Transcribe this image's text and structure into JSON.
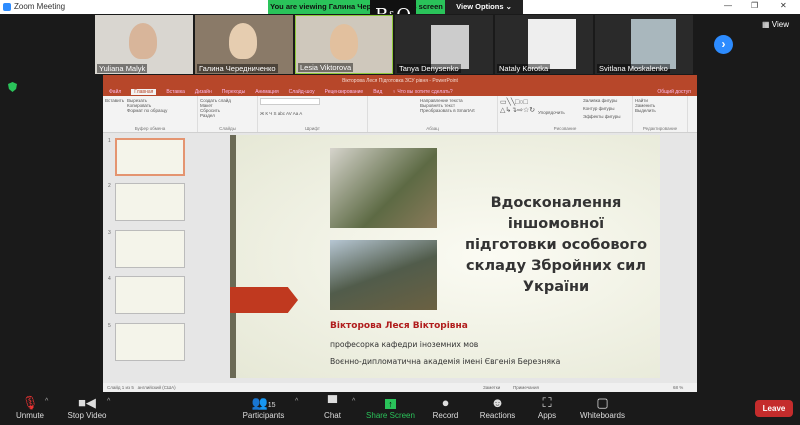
{
  "window": {
    "title": "Zoom Meeting",
    "minimize": "—",
    "restore": "❐",
    "close": "✕"
  },
  "banner": {
    "text": "You are viewing Галина Чередниченко's screen",
    "view_options": "View Options ⌄"
  },
  "logo": "B&O",
  "participants_strip": [
    {
      "name": "Yuliana Malyk",
      "muted": true
    },
    {
      "name": "Галина Чередниченко",
      "muted": false
    },
    {
      "name": "Lesia Viktorova",
      "muted": false,
      "active": true
    },
    {
      "name": "Tanya Denysenko",
      "muted": false
    },
    {
      "name": "Nataly Korotka",
      "muted": true
    },
    {
      "name": "Svitlana Moskalenko",
      "muted": true
    }
  ],
  "view_button": "View",
  "powerpoint": {
    "title": "Вікторова Леся Підготовка ЗСУ рівня - PowerPoint",
    "tabs": [
      "Файл",
      "Главная",
      "Вставка",
      "Дизайн",
      "Переходы",
      "Анимация",
      "Слайд-шоу",
      "Рецензирование",
      "Вид",
      "♀ Что вы хотите сделать?"
    ],
    "share": "Общий доступ",
    "ribbon_groups": [
      {
        "label": "Буфер обмена",
        "items": [
          "Вставить",
          "Вырезать",
          "Копировать",
          "Формат по образцу"
        ]
      },
      {
        "label": "Слайды",
        "items": [
          "Создать слайд",
          "Макет",
          "Сбросить",
          "Раздел"
        ]
      },
      {
        "label": "Шрифт",
        "items": [
          "Ж К Ч S abc AV Aa A"
        ]
      },
      {
        "label": "Абзац",
        "items": [
          "Направление текста",
          "Выровнять текст",
          "Преобразовать в SmartArt"
        ]
      },
      {
        "label": "Рисование",
        "items": [
          "Упорядочить",
          "Экспресс-стили",
          "Заливка фигуры",
          "Контур фигуры",
          "Эффекты фигуры"
        ]
      },
      {
        "label": "Редактирование",
        "items": [
          "Найти",
          "Заменить",
          "Выделить"
        ]
      }
    ],
    "thumbnails": [
      "1",
      "2",
      "3",
      "4",
      "5"
    ],
    "slide": {
      "title": "Вдосконалення іншомовної підготовки особового складу  Збройних сил України",
      "author": "Вікторова Леся Вікторівна",
      "position": "професорка кафедри іноземних мов",
      "institution": "Воєнно-дипломатична академія імені Євгенія Березняка"
    },
    "status": {
      "slide": "Слайд 1 из 5",
      "language": "английский (США)",
      "notes": "Заметки",
      "comments": "Примечания",
      "zoom": "68 %"
    }
  },
  "toolbar": [
    {
      "label": "Unmute",
      "icon": "mic-muted-icon"
    },
    {
      "label": "Stop Video",
      "icon": "video-icon"
    },
    {
      "label": "Participants",
      "icon": "participants-icon",
      "count": "15"
    },
    {
      "label": "Chat",
      "icon": "chat-icon"
    },
    {
      "label": "Share Screen",
      "icon": "share-screen-icon"
    },
    {
      "label": "Record",
      "icon": "record-icon"
    },
    {
      "label": "Reactions",
      "icon": "reactions-icon"
    },
    {
      "label": "Apps",
      "icon": "apps-icon"
    },
    {
      "label": "Whiteboards",
      "icon": "whiteboard-icon"
    }
  ],
  "leave": "Leave",
  "colors": {
    "accent_green": "#2ac35a",
    "leave_red": "#c42c2c",
    "ppt_red": "#b7472a"
  }
}
